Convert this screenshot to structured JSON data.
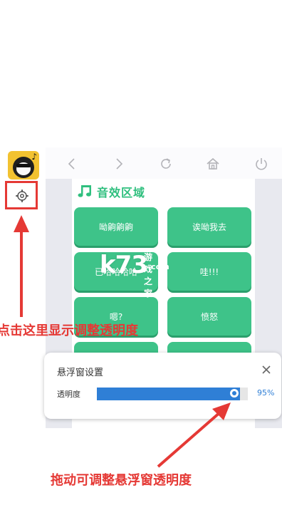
{
  "app_icon": {
    "name": "panda-music-app-icon"
  },
  "toolbar": {
    "buttons": [
      "back-icon",
      "forward-icon",
      "refresh-icon",
      "home-icon",
      "power-icon"
    ]
  },
  "section": {
    "title": "音效区域"
  },
  "sound_buttons": [
    {
      "label": "呦齁齁齁"
    },
    {
      "label": "诶呦我去"
    },
    {
      "label": "已哈哈哈哈"
    },
    {
      "label": "哇!!!"
    },
    {
      "label": "嗯?"
    },
    {
      "label": "愤怒"
    }
  ],
  "watermark": {
    "logo": "k73",
    "site_cn": "游戏之家",
    "domain": ".com"
  },
  "dialog": {
    "title": "悬浮窗设置",
    "opacity_label": "透明度",
    "opacity_value": "95%",
    "opacity_fraction": 0.95
  },
  "annotations": {
    "gear_hint": "点击这里显示调整透明度",
    "slider_hint": "拖动可调整悬浮窗透明度"
  },
  "colors": {
    "accent_green": "#3ec389",
    "slider_blue": "#2f7fd6",
    "annotation_red": "#e53935"
  }
}
